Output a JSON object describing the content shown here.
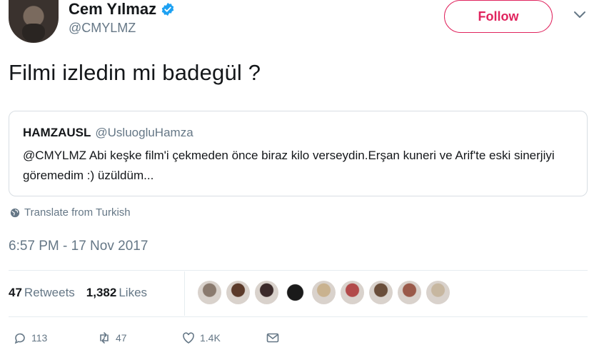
{
  "author": {
    "display_name": "Cem Yılmaz",
    "handle": "@CMYLMZ",
    "verified_icon": "verified-badge-icon",
    "avatar_icon": "avatar"
  },
  "follow_label": "Follow",
  "tweet_text": "Filmi izledin mi badegül ?",
  "quoted_tweet": {
    "name": "HAMZAUSL",
    "handle": "@UsluogluHamza",
    "text": "@CMYLMZ Abi keşke film'i çekmeden önce biraz kilo verseydin.Erşan kuneri ve Arif'te eski sinerjiyi göremedim :) üzüldüm..."
  },
  "translate_label": "Translate from Turkish",
  "timestamp": "6:57 PM - 17 Nov 2017",
  "stats": {
    "retweets_count": "47",
    "retweets_label": "Retweets",
    "likes_count": "1,382",
    "likes_label": "Likes"
  },
  "liker_avatars": [
    "#8a7a6e",
    "#5b3a2a",
    "#3b2a2a",
    "#1a1a1a",
    "#c9b28f",
    "#b24a4a",
    "#6a4e3a",
    "#9a5a4a",
    "#c7b7a0"
  ],
  "actions": {
    "reply_count": "113",
    "retweet_count": "47",
    "like_count": "1.4K"
  },
  "colors": {
    "accent": "#e0245e",
    "secondary_text": "#657786",
    "verified": "#1da1f2"
  }
}
